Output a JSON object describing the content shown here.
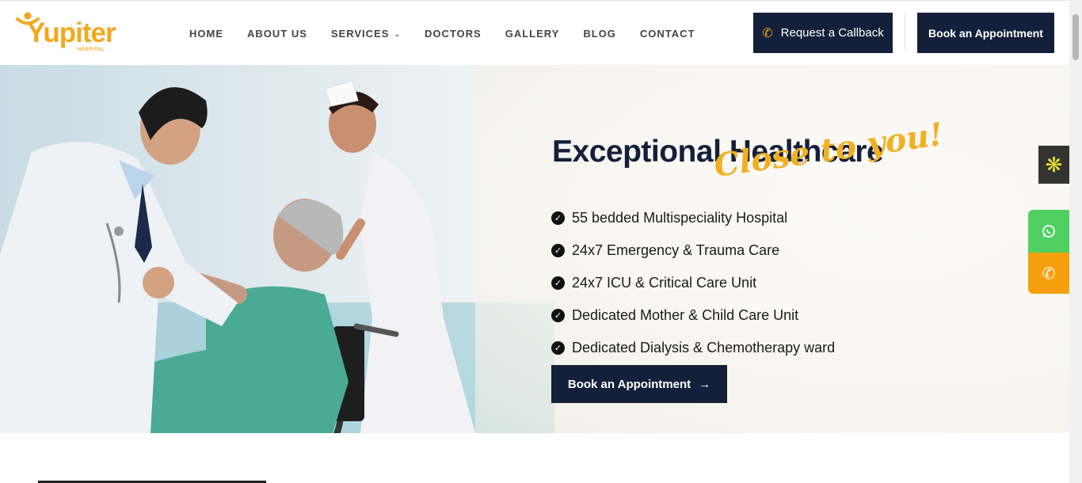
{
  "header": {
    "logo_text": "Yupiter",
    "logo_sub": "HOSPITAL",
    "nav": [
      {
        "label": "HOME"
      },
      {
        "label": "ABOUT US"
      },
      {
        "label": "SERVICES",
        "has_dropdown": true
      },
      {
        "label": "DOCTORS"
      },
      {
        "label": "GALLERY"
      },
      {
        "label": "BLOG"
      },
      {
        "label": "CONTACT"
      }
    ],
    "callback_label": "Request a Callback",
    "book_label": "Book an Appointment"
  },
  "hero": {
    "title": "Exceptional Healthcare",
    "script": "Close to you!",
    "features": [
      "55 bedded Multispeciality Hospital",
      "24x7 Emergency & Trauma Care",
      "24x7 ICU & Critical Care Unit",
      "Dedicated Mother & Child Care Unit",
      "Dedicated Dialysis & Chemotherapy ward"
    ],
    "cta_label": "Book an Appointment"
  },
  "colors": {
    "brand_yellow": "#f2a81d",
    "navy": "#14203a",
    "whatsapp_green": "#4fcf5f",
    "call_orange": "#f6a00e"
  },
  "icons": {
    "side_widget": "asterisk-icon",
    "whatsapp": "whatsapp-icon",
    "phone": "phone-icon"
  }
}
